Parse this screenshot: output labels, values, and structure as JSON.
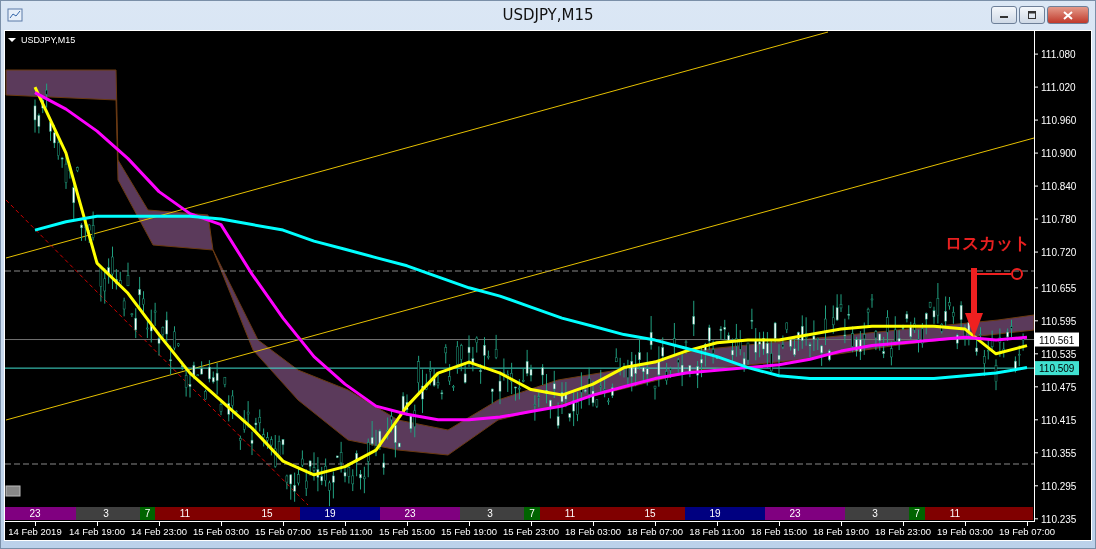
{
  "window": {
    "title": "USDJPY,M15"
  },
  "chart": {
    "label": "USDJPY,M15",
    "annotation": "ロスカット",
    "price_markers": [
      {
        "label": "110.561",
        "color": "#ffffff"
      },
      {
        "label": "110.509",
        "color": "#40e0d0"
      }
    ],
    "sessions": [
      {
        "label": "23",
        "color": "#800080"
      },
      {
        "label": "3",
        "color": "#404040"
      },
      {
        "label": "7",
        "color": "#006400"
      },
      {
        "label": "11",
        "color": "#800000"
      },
      {
        "label": "15",
        "color": "#800000"
      },
      {
        "label": "19",
        "color": "#000080"
      },
      {
        "label": "23",
        "color": "#800080"
      },
      {
        "label": "3",
        "color": "#404040"
      },
      {
        "label": "7",
        "color": "#006400"
      },
      {
        "label": "11",
        "color": "#800000"
      },
      {
        "label": "15",
        "color": "#800000"
      },
      {
        "label": "19",
        "color": "#000080"
      },
      {
        "label": "23",
        "color": "#800080"
      },
      {
        "label": "3",
        "color": "#404040"
      },
      {
        "label": "7",
        "color": "#006400"
      },
      {
        "label": "11",
        "color": "#800000"
      }
    ],
    "chart_data": {
      "type": "line",
      "categories": [
        "14 Feb 2019",
        null,
        "14 Feb 19:00",
        null,
        "14 Feb 23:00",
        null,
        "15 Feb 03:00",
        null,
        "15 Feb 07:00",
        null,
        "15 Feb 11:00",
        null,
        "15 Feb 15:00",
        null,
        "15 Feb 19:00",
        null,
        "15 Feb 23:00",
        null,
        "18 Feb 03:00",
        null,
        "18 Feb 07:00",
        null,
        "18 Feb 11:00",
        null,
        "18 Feb 15:00",
        null,
        "18 Feb 19:00",
        null,
        "18 Feb 23:00",
        null,
        "19 Feb 03:00",
        null,
        "19 Feb 07:00"
      ],
      "ylim": [
        110.231,
        111.122
      ],
      "yticks": [
        {
          "value": 111.08,
          "label": "111.080"
        },
        {
          "value": 111.02,
          "label": "111.020"
        },
        {
          "value": 110.96,
          "label": "110.960"
        },
        {
          "value": 110.9,
          "label": "110.900"
        },
        {
          "value": 110.84,
          "label": "110.840"
        },
        {
          "value": 110.78,
          "label": "110.780"
        },
        {
          "value": 110.72,
          "label": "110.720"
        },
        {
          "value": 110.655,
          "label": "110.655"
        },
        {
          "value": 110.595,
          "label": "110.595"
        },
        {
          "value": 110.535,
          "label": "110.535"
        },
        {
          "value": 110.475,
          "label": "110.475"
        },
        {
          "value": 110.415,
          "label": "110.415"
        },
        {
          "value": 110.355,
          "label": "110.355"
        },
        {
          "value": 110.295,
          "label": "110.295"
        },
        {
          "value": 110.235,
          "label": "110.235"
        }
      ],
      "series": [
        {
          "color": "#ffff00",
          "values": [
            111.02,
            110.9,
            110.7,
            110.645,
            110.57,
            110.5,
            110.45,
            110.4,
            110.34,
            110.315,
            110.33,
            110.36,
            110.44,
            110.5,
            110.52,
            110.5,
            110.47,
            110.46,
            110.48,
            110.51,
            110.52,
            110.54,
            110.555,
            110.56,
            110.56,
            110.57,
            110.58,
            110.585,
            110.585,
            110.585,
            110.58,
            110.535,
            110.55
          ]
        },
        {
          "color": "#ff00ff",
          "values": [
            111.01,
            110.98,
            110.94,
            110.89,
            110.83,
            110.79,
            110.77,
            110.68,
            110.6,
            110.53,
            110.48,
            110.44,
            110.425,
            110.415,
            110.415,
            110.42,
            110.43,
            110.44,
            110.46,
            110.475,
            110.49,
            110.5,
            110.505,
            110.51,
            110.515,
            110.525,
            110.54,
            110.55,
            110.555,
            110.56,
            110.565,
            110.56,
            110.565
          ]
        },
        {
          "color": "#00ffff",
          "values": [
            110.76,
            110.775,
            110.785,
            110.785,
            110.785,
            110.785,
            110.78,
            110.77,
            110.76,
            110.74,
            110.725,
            110.71,
            110.695,
            110.675,
            110.655,
            110.64,
            110.62,
            110.6,
            110.585,
            110.57,
            110.56,
            110.545,
            110.53,
            110.51,
            110.495,
            110.49,
            110.49,
            110.49,
            110.49,
            110.49,
            110.495,
            110.5,
            110.51
          ]
        }
      ]
    }
  }
}
